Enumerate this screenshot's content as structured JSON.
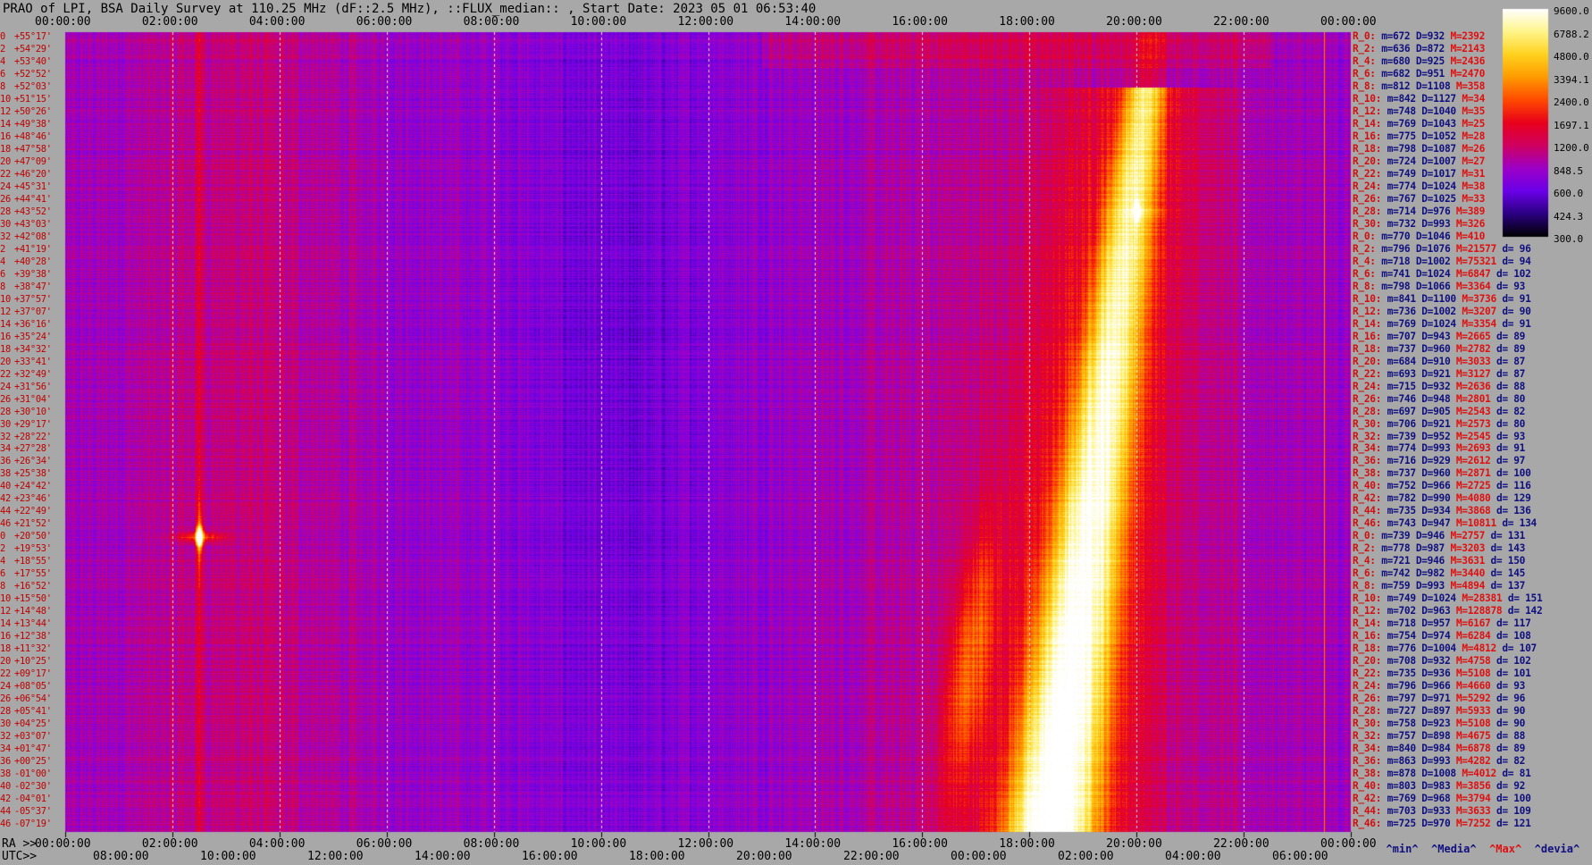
{
  "title": "PRAO of LPI, BSA Daily Survey at 110.25 MHz (dF::2.5 MHz), ::FLUX_median:: , Start Date: 2023 05 01 06:53:40",
  "top_axis_ticks": [
    "00:00:00",
    "02:00:00",
    "04:00:00",
    "06:00:00",
    "08:00:00",
    "10:00:00",
    "12:00:00",
    "14:00:00",
    "16:00:00",
    "18:00:00",
    "20:00:00",
    "22:00:00",
    "00:00:00"
  ],
  "ra_axis": {
    "label": "RA >>",
    "ticks": [
      "00:00:00",
      "02:00:00",
      "04:00:00",
      "06:00:00",
      "08:00:00",
      "10:00:00",
      "12:00:00",
      "14:00:00",
      "16:00:00",
      "18:00:00",
      "20:00:00",
      "22:00:00",
      "00:00:00"
    ]
  },
  "utc_axis": {
    "label": "UTC>>",
    "ticks": [
      "08:00:00",
      "10:00:00",
      "12:00:00",
      "14:00:00",
      "16:00:00",
      "18:00:00",
      "20:00:00",
      "22:00:00",
      "00:00:00",
      "02:00:00",
      "04:00:00",
      "06:00:00"
    ]
  },
  "colorbar": {
    "ticks": [
      "9600.0",
      "6788.2",
      "4800.0",
      "3394.1",
      "2400.0",
      "1697.1",
      "1200.0",
      "848.5",
      "600.0",
      "424.3",
      "300.0"
    ],
    "colors": [
      "#ffffff",
      "#fff58a",
      "#ffd21e",
      "#ff9a00",
      "#ff4a00",
      "#e8001c",
      "#d00060",
      "#9d00c8",
      "#6a00e8",
      "#2a0080",
      "#000000"
    ]
  },
  "declinations": [
    {
      "idx": "0",
      "dec": "+55°17'"
    },
    {
      "idx": "2",
      "dec": "+54°29'"
    },
    {
      "idx": "4",
      "dec": "+53°40'"
    },
    {
      "idx": "6",
      "dec": "+52°52'"
    },
    {
      "idx": "8",
      "dec": "+52°03'"
    },
    {
      "idx": "10",
      "dec": "+51°15'"
    },
    {
      "idx": "12",
      "dec": "+50°26'"
    },
    {
      "idx": "14",
      "dec": "+49°38'"
    },
    {
      "idx": "16",
      "dec": "+48°46'"
    },
    {
      "idx": "18",
      "dec": "+47°58'"
    },
    {
      "idx": "20",
      "dec": "+47°09'"
    },
    {
      "idx": "22",
      "dec": "+46°20'"
    },
    {
      "idx": "24",
      "dec": "+45°31'"
    },
    {
      "idx": "26",
      "dec": "+44°41'"
    },
    {
      "idx": "28",
      "dec": "+43°52'"
    },
    {
      "idx": "30",
      "dec": "+43°03'"
    },
    {
      "idx": "32",
      "dec": "+42°08'"
    },
    {
      "idx": "2",
      "dec": "+41°19'"
    },
    {
      "idx": "4",
      "dec": "+40°28'"
    },
    {
      "idx": "6",
      "dec": "+39°38'"
    },
    {
      "idx": "8",
      "dec": "+38°47'"
    },
    {
      "idx": "10",
      "dec": "+37°57'"
    },
    {
      "idx": "12",
      "dec": "+37°07'"
    },
    {
      "idx": "14",
      "dec": "+36°16'"
    },
    {
      "idx": "16",
      "dec": "+35°24'"
    },
    {
      "idx": "18",
      "dec": "+34°32'"
    },
    {
      "idx": "20",
      "dec": "+33°41'"
    },
    {
      "idx": "22",
      "dec": "+32°49'"
    },
    {
      "idx": "24",
      "dec": "+31°56'"
    },
    {
      "idx": "26",
      "dec": "+31°04'"
    },
    {
      "idx": "28",
      "dec": "+30°10'"
    },
    {
      "idx": "30",
      "dec": "+29°17'"
    },
    {
      "idx": "32",
      "dec": "+28°22'"
    },
    {
      "idx": "34",
      "dec": "+27°28'"
    },
    {
      "idx": "36",
      "dec": "+26°34'"
    },
    {
      "idx": "38",
      "dec": "+25°38'"
    },
    {
      "idx": "40",
      "dec": "+24°42'"
    },
    {
      "idx": "42",
      "dec": "+23°46'"
    },
    {
      "idx": "44",
      "dec": "+22°49'"
    },
    {
      "idx": "46",
      "dec": "+21°52'"
    },
    {
      "idx": "0",
      "dec": "+20°50'"
    },
    {
      "idx": "2",
      "dec": "+19°53'"
    },
    {
      "idx": "4",
      "dec": "+18°55'"
    },
    {
      "idx": "6",
      "dec": "+17°55'"
    },
    {
      "idx": "8",
      "dec": "+16°52'"
    },
    {
      "idx": "10",
      "dec": "+15°50'"
    },
    {
      "idx": "12",
      "dec": "+14°48'"
    },
    {
      "idx": "14",
      "dec": "+13°44'"
    },
    {
      "idx": "16",
      "dec": "+12°38'"
    },
    {
      "idx": "18",
      "dec": "+11°32'"
    },
    {
      "idx": "20",
      "dec": "+10°25'"
    },
    {
      "idx": "22",
      "dec": "+09°17'"
    },
    {
      "idx": "24",
      "dec": "+08°05'"
    },
    {
      "idx": "26",
      "dec": "+06°54'"
    },
    {
      "idx": "28",
      "dec": "+05°41'"
    },
    {
      "idx": "30",
      "dec": "+04°25'"
    },
    {
      "idx": "32",
      "dec": "+03°07'"
    },
    {
      "idx": "34",
      "dec": "+01°47'"
    },
    {
      "idx": "36",
      "dec": "+00°25'"
    },
    {
      "idx": "38",
      "dec": "-01°00'"
    },
    {
      "idx": "40",
      "dec": "-02°30'"
    },
    {
      "idx": "42",
      "dec": "-04°01'"
    },
    {
      "idx": "44",
      "dec": "-05°37'"
    },
    {
      "idx": "46",
      "dec": "-07°19'"
    }
  ],
  "stats": [
    {
      "lab": "R_0:",
      "m": "m=672",
      "d": "D=932",
      "M": "M=2392",
      "dd": ""
    },
    {
      "lab": "R_2:",
      "m": "m=636",
      "d": "D=872",
      "M": "M=2143",
      "dd": ""
    },
    {
      "lab": "R_4:",
      "m": "m=680",
      "d": "D=925",
      "M": "M=2436",
      "dd": ""
    },
    {
      "lab": "R_6:",
      "m": "m=682",
      "d": "D=951",
      "M": "M=2470",
      "dd": ""
    },
    {
      "lab": "R_8:",
      "m": "m=812",
      "d": "D=1108",
      "M": "M=358",
      "dd": ""
    },
    {
      "lab": "R_10:",
      "m": "m=842",
      "d": "D=1127",
      "M": "M=34",
      "dd": ""
    },
    {
      "lab": "R_12:",
      "m": "m=748",
      "d": "D=1040",
      "M": "M=35",
      "dd": ""
    },
    {
      "lab": "R_14:",
      "m": "m=769",
      "d": "D=1043",
      "M": "M=25",
      "dd": ""
    },
    {
      "lab": "R_16:",
      "m": "m=775",
      "d": "D=1052",
      "M": "M=28",
      "dd": ""
    },
    {
      "lab": "R_18:",
      "m": "m=798",
      "d": "D=1087",
      "M": "M=26",
      "dd": ""
    },
    {
      "lab": "R_20:",
      "m": "m=724",
      "d": "D=1007",
      "M": "M=27",
      "dd": ""
    },
    {
      "lab": "R_22:",
      "m": "m=749",
      "d": "D=1017",
      "M": "M=31",
      "dd": ""
    },
    {
      "lab": "R_24:",
      "m": "m=774",
      "d": "D=1024",
      "M": "M=38",
      "dd": ""
    },
    {
      "lab": "R_26:",
      "m": "m=767",
      "d": "D=1025",
      "M": "M=33",
      "dd": ""
    },
    {
      "lab": "R_28:",
      "m": "m=714",
      "d": "D=976",
      "M": "M=389",
      "dd": ""
    },
    {
      "lab": "R_30:",
      "m": "m=732",
      "d": "D=993",
      "M": "M=326",
      "dd": ""
    },
    {
      "lab": "R_0:",
      "m": "m=770",
      "d": "D=1046",
      "M": "M=410",
      "dd": ""
    },
    {
      "lab": "R_2:",
      "m": "m=796",
      "d": "D=1076",
      "M": "M=21577",
      "dd": "d= 96"
    },
    {
      "lab": "R_4:",
      "m": "m=718",
      "d": "D=1002",
      "M": "M=75321",
      "dd": "d= 94"
    },
    {
      "lab": "R_6:",
      "m": "m=741",
      "d": "D=1024",
      "M": "M=6847",
      "dd": "d= 102"
    },
    {
      "lab": "R_8:",
      "m": "m=798",
      "d": "D=1066",
      "M": "M=3364",
      "dd": "d= 93"
    },
    {
      "lab": "R_10:",
      "m": "m=841",
      "d": "D=1100",
      "M": "M=3736",
      "dd": "d= 91"
    },
    {
      "lab": "R_12:",
      "m": "m=736",
      "d": "D=1002",
      "M": "M=3207",
      "dd": "d= 90"
    },
    {
      "lab": "R_14:",
      "m": "m=769",
      "d": "D=1024",
      "M": "M=3354",
      "dd": "d= 91"
    },
    {
      "lab": "R_16:",
      "m": "m=707",
      "d": "D=943",
      "M": "M=2665",
      "dd": "d= 89"
    },
    {
      "lab": "R_18:",
      "m": "m=737",
      "d": "D=960",
      "M": "M=2782",
      "dd": "d= 89"
    },
    {
      "lab": "R_20:",
      "m": "m=684",
      "d": "D=910",
      "M": "M=3033",
      "dd": "d= 87"
    },
    {
      "lab": "R_22:",
      "m": "m=693",
      "d": "D=921",
      "M": "M=3127",
      "dd": "d= 87"
    },
    {
      "lab": "R_24:",
      "m": "m=715",
      "d": "D=932",
      "M": "M=2636",
      "dd": "d= 88"
    },
    {
      "lab": "R_26:",
      "m": "m=746",
      "d": "D=948",
      "M": "M=2801",
      "dd": "d= 80"
    },
    {
      "lab": "R_28:",
      "m": "m=697",
      "d": "D=905",
      "M": "M=2543",
      "dd": "d= 82"
    },
    {
      "lab": "R_30:",
      "m": "m=706",
      "d": "D=921",
      "M": "M=2573",
      "dd": "d= 80"
    },
    {
      "lab": "R_32:",
      "m": "m=739",
      "d": "D=952",
      "M": "M=2545",
      "dd": "d= 93"
    },
    {
      "lab": "R_34:",
      "m": "m=774",
      "d": "D=993",
      "M": "M=2693",
      "dd": "d= 91"
    },
    {
      "lab": "R_36:",
      "m": "m=716",
      "d": "D=929",
      "M": "M=2612",
      "dd": "d= 97"
    },
    {
      "lab": "R_38:",
      "m": "m=737",
      "d": "D=960",
      "M": "M=2871",
      "dd": "d= 100"
    },
    {
      "lab": "R_40:",
      "m": "m=752",
      "d": "D=966",
      "M": "M=2725",
      "dd": "d= 116"
    },
    {
      "lab": "R_42:",
      "m": "m=782",
      "d": "D=990",
      "M": "M=4080",
      "dd": "d= 129"
    },
    {
      "lab": "R_44:",
      "m": "m=735",
      "d": "D=934",
      "M": "M=3868",
      "dd": "d= 136"
    },
    {
      "lab": "R_46:",
      "m": "m=743",
      "d": "D=947",
      "M": "M=10811",
      "dd": "d= 134"
    },
    {
      "lab": "R_0:",
      "m": "m=739",
      "d": "D=946",
      "M": "M=2757",
      "dd": "d= 131"
    },
    {
      "lab": "R_2:",
      "m": "m=778",
      "d": "D=987",
      "M": "M=3203",
      "dd": "d= 143"
    },
    {
      "lab": "R_4:",
      "m": "m=721",
      "d": "D=946",
      "M": "M=3631",
      "dd": "d= 150"
    },
    {
      "lab": "R_6:",
      "m": "m=742",
      "d": "D=982",
      "M": "M=3440",
      "dd": "d= 145"
    },
    {
      "lab": "R_8:",
      "m": "m=759",
      "d": "D=993",
      "M": "M=4894",
      "dd": "d= 137"
    },
    {
      "lab": "R_10:",
      "m": "m=749",
      "d": "D=1024",
      "M": "M=28381",
      "dd": "d= 151"
    },
    {
      "lab": "R_12:",
      "m": "m=702",
      "d": "D=963",
      "M": "M=128878",
      "dd": "d= 142"
    },
    {
      "lab": "R_14:",
      "m": "m=718",
      "d": "D=957",
      "M": "M=6167",
      "dd": "d= 117"
    },
    {
      "lab": "R_16:",
      "m": "m=754",
      "d": "D=974",
      "M": "M=6284",
      "dd": "d= 108"
    },
    {
      "lab": "R_18:",
      "m": "m=776",
      "d": "D=1004",
      "M": "M=4812",
      "dd": "d= 107"
    },
    {
      "lab": "R_20:",
      "m": "m=708",
      "d": "D=932",
      "M": "M=4758",
      "dd": "d= 102"
    },
    {
      "lab": "R_22:",
      "m": "m=735",
      "d": "D=936",
      "M": "M=5108",
      "dd": "d= 101"
    },
    {
      "lab": "R_24:",
      "m": "m=796",
      "d": "D=966",
      "M": "M=4660",
      "dd": "d= 93"
    },
    {
      "lab": "R_26:",
      "m": "m=797",
      "d": "D=971",
      "M": "M=5292",
      "dd": "d= 96"
    },
    {
      "lab": "R_28:",
      "m": "m=727",
      "d": "D=897",
      "M": "M=5933",
      "dd": "d= 90"
    },
    {
      "lab": "R_30:",
      "m": "m=758",
      "d": "D=923",
      "M": "M=5108",
      "dd": "d= 90"
    },
    {
      "lab": "R_32:",
      "m": "m=757",
      "d": "D=898",
      "M": "M=4675",
      "dd": "d= 88"
    },
    {
      "lab": "R_34:",
      "m": "m=840",
      "d": "D=984",
      "M": "M=6878",
      "dd": "d= 89"
    },
    {
      "lab": "R_36:",
      "m": "m=863",
      "d": "D=993",
      "M": "M=4282",
      "dd": "d= 82"
    },
    {
      "lab": "R_38:",
      "m": "m=878",
      "d": "D=1008",
      "M": "M=4012",
      "dd": "d= 81"
    },
    {
      "lab": "R_40:",
      "m": "m=803",
      "d": "D=983",
      "M": "M=3856",
      "dd": "d= 92"
    },
    {
      "lab": "R_42:",
      "m": "m=769",
      "d": "D=968",
      "M": "M=3794",
      "dd": "d= 100"
    },
    {
      "lab": "R_44:",
      "m": "m=703",
      "d": "D=933",
      "M": "M=3633",
      "dd": "d= 109"
    },
    {
      "lab": "R_46:",
      "m": "m=725",
      "d": "D=970",
      "M": "M=7252",
      "dd": "d= 121"
    }
  ],
  "bottom_legend": {
    "min": "^min^",
    "media": "^Media^",
    "max": "^Max^",
    "devia": "^devia^"
  },
  "chart_data": {
    "type": "heatmap",
    "title": "PRAO of LPI, BSA Daily Survey at 110.25 MHz (dF::2.5 MHz), ::FLUX_median:: , Start Date: 2023 05 01 06:53:40",
    "x": {
      "unit": "RA (h)",
      "range": [
        0,
        24
      ],
      "ticks_h": [
        0,
        2,
        4,
        6,
        8,
        10,
        12,
        14,
        16,
        18,
        20,
        22,
        24
      ]
    },
    "y": {
      "unit": "Declination (deg)",
      "range": [
        55.28,
        -7.32
      ]
    },
    "color_scale": {
      "type": "log",
      "range": [
        300,
        9600
      ]
    },
    "features": [
      {
        "kind": "point_source",
        "ra_h": 2.5,
        "dec": 15.8,
        "value": 9600
      },
      {
        "kind": "point_source",
        "ra_h": 20.0,
        "dec": 41.3,
        "value": 9600
      },
      {
        "kind": "galactic_plane_band",
        "ra_h_at_dec_max": 20.3,
        "ra_h_at_dec_min": 18.4,
        "value": 6800
      }
    ]
  }
}
